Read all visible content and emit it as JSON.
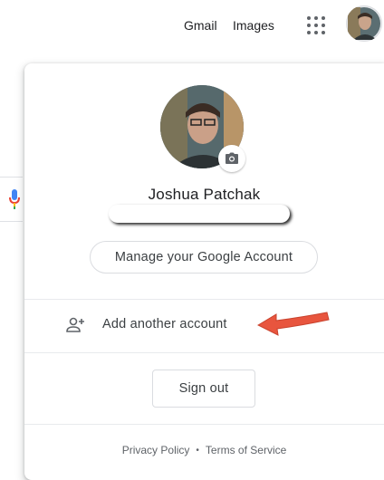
{
  "topbar": {
    "gmail_label": "Gmail",
    "images_label": "Images",
    "apps_icon": "apps-grid-icon",
    "avatar_icon": "account-avatar"
  },
  "account_panel": {
    "user_name": "Joshua Patchak",
    "change_photo_icon": "camera-icon",
    "manage_account_label": "Manage your Google Account",
    "add_account_label": "Add another account",
    "add_account_icon": "person-add-icon",
    "annotation_icon": "red-arrow-icon",
    "sign_out_label": "Sign out",
    "footer": {
      "privacy_label": "Privacy Policy",
      "separator": "•",
      "terms_label": "Terms of Service"
    }
  },
  "colors": {
    "text_primary": "#202124",
    "text_secondary": "#3c4043",
    "border": "#dadce0",
    "arrow_red": "#e8553e",
    "mic_blue": "#4285f4",
    "mic_red": "#ea4335",
    "mic_yellow": "#fbbc04"
  }
}
